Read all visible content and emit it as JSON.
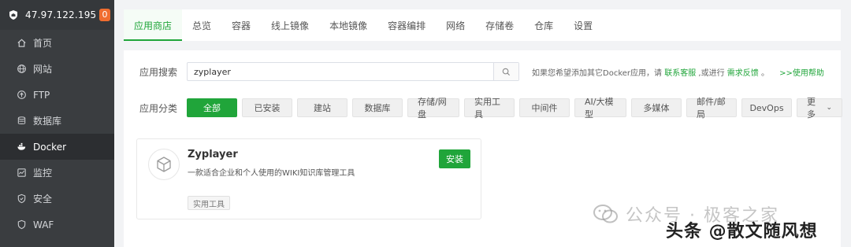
{
  "sidebar": {
    "ip": "47.97.122.195",
    "badge": "0",
    "items": [
      {
        "label": "首页",
        "icon": "home-icon"
      },
      {
        "label": "网站",
        "icon": "globe-icon"
      },
      {
        "label": "FTP",
        "icon": "ftp-icon"
      },
      {
        "label": "数据库",
        "icon": "database-icon"
      },
      {
        "label": "Docker",
        "icon": "docker-icon",
        "active": true
      },
      {
        "label": "监控",
        "icon": "monitor-icon"
      },
      {
        "label": "安全",
        "icon": "shield-icon"
      },
      {
        "label": "WAF",
        "icon": "waf-icon"
      }
    ]
  },
  "tabs": [
    "应用商店",
    "总览",
    "容器",
    "线上镜像",
    "本地镜像",
    "容器编排",
    "网络",
    "存储卷",
    "仓库",
    "设置"
  ],
  "search": {
    "label": "应用搜索",
    "value": "zyplayer",
    "hint_prefix": "如果您希望添加其它Docker应用，请",
    "hint_link1": "联系客服",
    "hint_mid": ",或进行",
    "hint_link2": "需求反馈",
    "hint_suffix": "。",
    "help": ">>使用帮助"
  },
  "categories": {
    "label": "应用分类",
    "items": [
      "全部",
      "已安装",
      "建站",
      "数据库",
      "存储/网盘",
      "实用工具",
      "中间件",
      "AI/大模型",
      "多媒体",
      "邮件/邮局",
      "DevOps",
      "更多"
    ]
  },
  "app": {
    "name": "Zyplayer",
    "desc": "一款适合企业和个人使用的WIKI知识库管理工具",
    "install": "安装",
    "tag": "实用工具"
  },
  "watermark": {
    "line1": "公众号 · 极客之家",
    "line2": "头条 @散文随风想"
  },
  "colors": {
    "accent": "#20a53a",
    "sidebar_bg": "#3a3d40",
    "badge": "#f06d2f"
  }
}
